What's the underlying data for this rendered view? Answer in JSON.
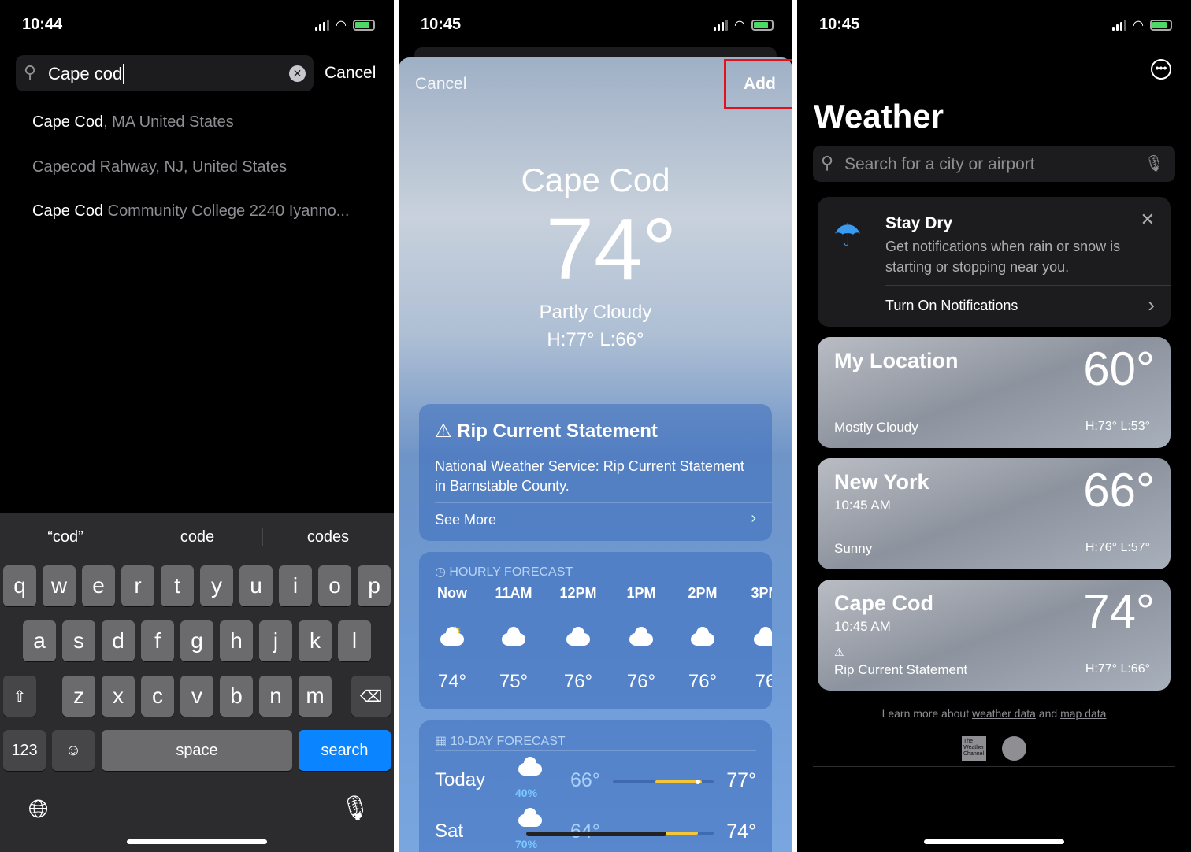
{
  "search_screen": {
    "time": "10:44",
    "search_value": "Cape cod",
    "cancel": "Cancel",
    "results": [
      {
        "match": "Cape Cod",
        "rest": ", MA United States"
      },
      {
        "match": "",
        "rest": "Capecod Rahway, NJ, United States"
      },
      {
        "match": "Cape Cod",
        "rest": " Community College 2240 Iyanno..."
      }
    ],
    "keyboard": {
      "suggestions": [
        "“cod”",
        "code",
        "codes"
      ],
      "row1": [
        "q",
        "w",
        "e",
        "r",
        "t",
        "y",
        "u",
        "i",
        "o",
        "p"
      ],
      "row2": [
        "a",
        "s",
        "d",
        "f",
        "g",
        "h",
        "j",
        "k",
        "l"
      ],
      "row3": [
        "z",
        "x",
        "c",
        "v",
        "b",
        "n",
        "m"
      ],
      "numbers": "123",
      "space": "space",
      "search": "search"
    }
  },
  "preview_screen": {
    "time": "10:45",
    "cancel": "Cancel",
    "add": "Add",
    "highlight_color": "#e0121b",
    "city": "Cape Cod",
    "temp": "74°",
    "condition": "Partly Cloudy",
    "hilo": "H:77°  L:66°",
    "alert": {
      "title": "Rip Current Statement",
      "body": "National Weather Service: Rip Current Statement in Barnstable County.",
      "link": "See More"
    },
    "hourly": {
      "title": "HOURLY FORECAST",
      "items": [
        {
          "time": "Now",
          "icon": "partly-sunny",
          "temp": "74°"
        },
        {
          "time": "11AM",
          "icon": "cloud",
          "temp": "75°"
        },
        {
          "time": "12PM",
          "icon": "cloud",
          "temp": "76°"
        },
        {
          "time": "1PM",
          "icon": "cloud",
          "temp": "76°"
        },
        {
          "time": "2PM",
          "icon": "cloud",
          "temp": "76°"
        },
        {
          "time": "3PM",
          "icon": "cloud",
          "temp": "76"
        }
      ]
    },
    "daily": {
      "title": "10-DAY FORECAST",
      "items": [
        {
          "day": "Today",
          "icon": "thunderstorm",
          "precip": "40%",
          "low": "66°",
          "high": "77°"
        },
        {
          "day": "Sat",
          "icon": "rain",
          "precip": "70%",
          "low": "64°",
          "high": "74°"
        }
      ]
    }
  },
  "list_screen": {
    "time": "10:45",
    "title": "Weather",
    "search_placeholder": "Search for a city or airport",
    "banner": {
      "title": "Stay Dry",
      "body": "Get notifications when rain or snow is starting or stopping near you.",
      "action": "Turn On Notifications"
    },
    "locations": [
      {
        "name": "My Location",
        "sub": "",
        "condition": "Mostly Cloudy",
        "temp": "60°",
        "hilo": "H:73°  L:53°"
      },
      {
        "name": "New York",
        "sub": "10:45 AM",
        "condition": "Sunny",
        "temp": "66°",
        "hilo": "H:76°  L:57°"
      },
      {
        "name": "Cape Cod",
        "sub": "10:45 AM",
        "condition": "Rip Current Statement",
        "temp": "74°",
        "hilo": "H:77°  L:66°"
      }
    ],
    "footer": {
      "prefix": "Learn more about ",
      "link1": "weather data",
      "mid": " and ",
      "link2": "map data",
      "logo": "The Weather Channel"
    }
  }
}
